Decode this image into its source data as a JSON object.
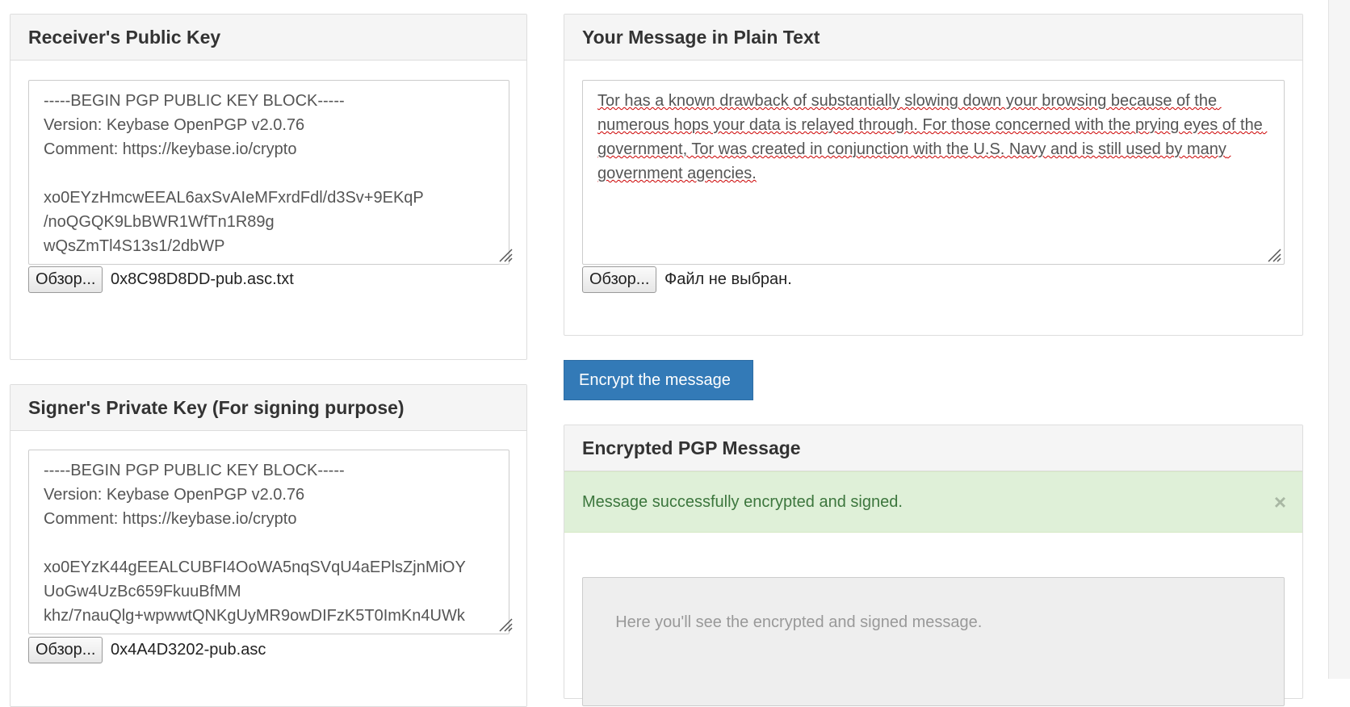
{
  "receiver_panel": {
    "title": "Receiver's Public Key",
    "key_text": "-----BEGIN PGP PUBLIC KEY BLOCK-----\nVersion: Keybase OpenPGP v2.0.76\nComment: https://keybase.io/crypto\n\nxo0EYzHmcwEEAL6axSvAIeMFxrdFdl/d3Sv+9EKqP\n/noQGQK9LbBWR1WfTn1R89g\nwQsZmTl4S13s1/2dbWP",
    "browse_label": "Обзор...",
    "file_name": "0x8C98D8DD-pub.asc.txt"
  },
  "signer_panel": {
    "title": "Signer's Private Key (For signing purpose)",
    "key_text": "-----BEGIN PGP PUBLIC KEY BLOCK-----\nVersion: Keybase OpenPGP v2.0.76\nComment: https://keybase.io/crypto\n\nxo0EYzK44gEEALCUBFI4OoWA5nqSVqU4aEPlsZjnMiOY\nUoGw4UzBc659FkuuBfMM\nkhz/7nauQlg+wpwwtQNKgUyMR9owDIFzK5T0ImKn4UWk",
    "browse_label": "Обзор...",
    "file_name": "0x4A4D3202-pub.asc"
  },
  "message_panel": {
    "title": "Your Message in Plain Text",
    "message_text": "Tor has a known drawback of substantially slowing down your browsing because of the numerous hops your data is relayed through. For those concerned with the prying eyes of the government, Tor was created in conjunction with the U.S. Navy and is still used by many government agencies.",
    "browse_label": "Обзор...",
    "file_status": "Файл не выбран."
  },
  "encrypt_button_label": "Encrypt the message",
  "encrypted_panel": {
    "title": "Encrypted PGP Message",
    "alert_text": "Message successfully encrypted and signed.",
    "alert_close": "×",
    "output_placeholder": "Here you'll see the encrypted and signed message."
  },
  "colors": {
    "primary": "#337ab7",
    "success_bg": "#dff0d8",
    "success_text": "#3c763d",
    "panel_heading_bg": "#f5f5f5"
  }
}
